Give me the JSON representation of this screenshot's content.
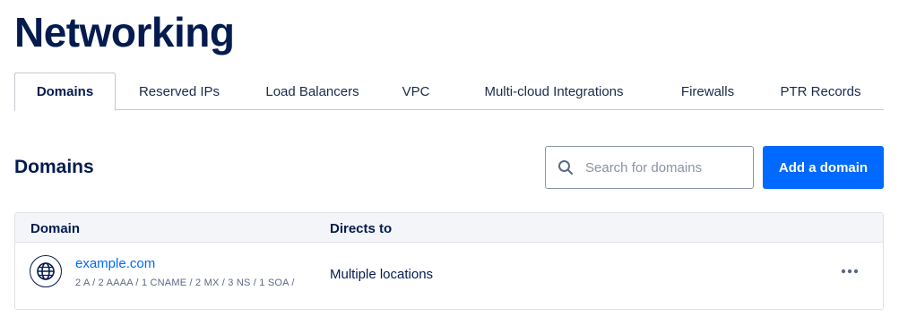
{
  "page": {
    "title": "Networking"
  },
  "tabs": [
    {
      "label": "Domains",
      "active": true
    },
    {
      "label": "Reserved IPs",
      "active": false
    },
    {
      "label": "Load Balancers",
      "active": false
    },
    {
      "label": "VPC",
      "active": false
    },
    {
      "label": "Multi-cloud Integrations",
      "active": false
    },
    {
      "label": "Firewalls",
      "active": false
    },
    {
      "label": "PTR Records",
      "active": false
    }
  ],
  "section": {
    "title": "Domains"
  },
  "search": {
    "placeholder": "Search for domains",
    "value": "",
    "icon": "search-icon"
  },
  "toolbar": {
    "add_label": "Add a domain"
  },
  "table": {
    "columns": [
      "Domain",
      "Directs to"
    ],
    "rows": [
      {
        "domain": "example.com",
        "records": "2 A / 2 AAAA / 1 CNAME / 2 MX / 3 NS / 1 SOA /",
        "directs_to": "Multiple locations",
        "icon": "globe-icon",
        "menu_icon": "more-icon"
      }
    ]
  },
  "colors": {
    "accent": "#0069ff",
    "text": "#031b4e",
    "border": "#dfe1e6",
    "header_bg": "#f3f5f9"
  }
}
